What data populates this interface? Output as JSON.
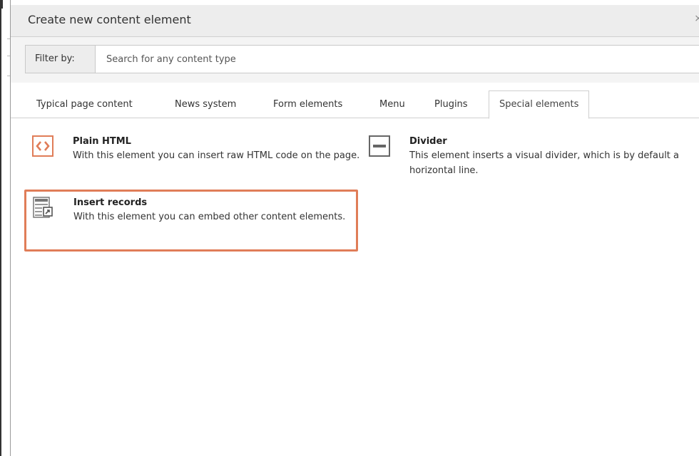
{
  "modal": {
    "title": "Create new content element",
    "close_symbol": "×"
  },
  "filter": {
    "label": "Filter by:",
    "placeholder": "Search for any content type",
    "value": ""
  },
  "tabs": [
    {
      "label": "Typical page content",
      "active": false
    },
    {
      "label": "News system",
      "active": false
    },
    {
      "label": "Form elements",
      "active": false
    },
    {
      "label": "Menu",
      "active": false
    },
    {
      "label": "Plugins",
      "active": false
    },
    {
      "label": "Special elements",
      "active": true
    }
  ],
  "elements": [
    {
      "title": "Plain HTML",
      "description": "With this element you can insert raw HTML code on the page.",
      "icon": "html-code-icon"
    },
    {
      "title": "Divider",
      "description": "This element inserts a visual divider, which is by default a horizontal line.",
      "icon": "divider-icon"
    },
    {
      "title": "Insert records",
      "description": "With this element you can embed other content elements.",
      "icon": "insert-records-icon",
      "selected": true
    }
  ],
  "colors": {
    "accent_orange": "#e07d58",
    "header_bg": "#ededed",
    "border": "#cfcfcf"
  }
}
